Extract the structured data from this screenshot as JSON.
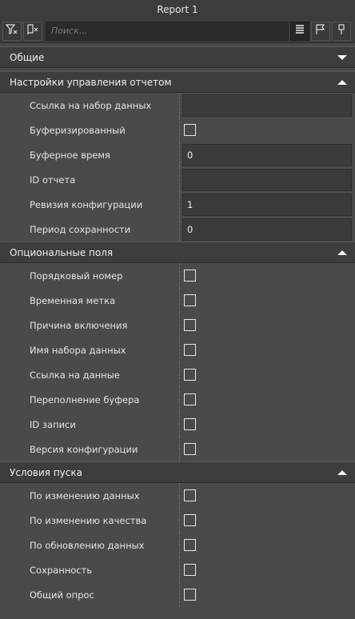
{
  "window": {
    "title": "Report 1"
  },
  "toolbar": {
    "search_placeholder": "Поиск...",
    "icons": [
      "filter-icon",
      "reset-filter-icon",
      "list-view-icon",
      "flag-icon",
      "pin-icon"
    ]
  },
  "sections": {
    "general": {
      "title": "Общие",
      "expanded": false
    },
    "control": {
      "title": "Настройки управления отчетом",
      "expanded": true,
      "rows": [
        {
          "label": "Ссылка на набор данных",
          "type": "text",
          "value": ""
        },
        {
          "label": "Буферизированный",
          "type": "checkbox",
          "checked": false
        },
        {
          "label": "Буферное время",
          "type": "text",
          "value": "0"
        },
        {
          "label": "ID отчета",
          "type": "text",
          "value": ""
        },
        {
          "label": "Ревизия конфигурации",
          "type": "text",
          "value": "1"
        },
        {
          "label": "Период сохранности",
          "type": "text",
          "value": "0"
        }
      ]
    },
    "optional": {
      "title": "Опциональные поля",
      "expanded": true,
      "rows": [
        {
          "label": "Порядковый номер",
          "checked": false
        },
        {
          "label": "Временная метка",
          "checked": false
        },
        {
          "label": "Причина включения",
          "checked": false
        },
        {
          "label": "Имя набора данных",
          "checked": false
        },
        {
          "label": "Ссылка на данные",
          "checked": false
        },
        {
          "label": "Переполнение буфера",
          "checked": false
        },
        {
          "label": "ID записи",
          "checked": false
        },
        {
          "label": "Версия конфигурации",
          "checked": false
        }
      ]
    },
    "triggers": {
      "title": "Условия пуска",
      "expanded": true,
      "rows": [
        {
          "label": "По изменению данных",
          "checked": false
        },
        {
          "label": "По изменению качества",
          "checked": false
        },
        {
          "label": "По обновлению данных",
          "checked": false
        },
        {
          "label": "Сохранность",
          "checked": false
        },
        {
          "label": "Общий опрос",
          "checked": false
        }
      ]
    }
  }
}
